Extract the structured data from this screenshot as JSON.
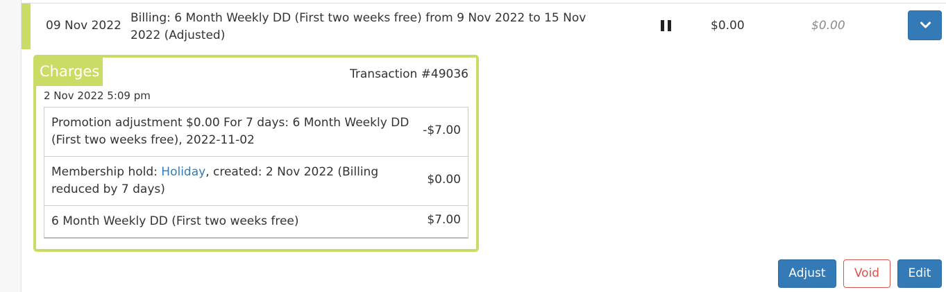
{
  "transaction_row": {
    "date": "09 Nov 2022",
    "description": "Billing: 6 Month Weekly DD (First two weeks free) from 9 Nov 2022 to 15 Nov 2022 (Adjusted)",
    "status_icon": "pause-icon",
    "amount": "$0.00",
    "balance": "$0.00",
    "expand_icon": "chevron-down-icon",
    "marker_color": "#cbdc66"
  },
  "charges_panel": {
    "tag": "Charges",
    "transaction_number": "Transaction #49036",
    "timestamp": "2 Nov 2022 5:09 pm",
    "accent_color": "#cbdc66",
    "items": [
      {
        "description": "Promotion adjustment $0.00 For 7 days: 6 Month Weekly DD (First two weeks free), 2022-11-02",
        "amount": "-$7.00"
      },
      {
        "prefix": "Membership hold: ",
        "link_text": "Holiday",
        "suffix": ", created: 2 Nov 2022 (Billing reduced by 7 days)",
        "amount": "$0.00"
      },
      {
        "description": "6 Month Weekly DD (First two weeks free)",
        "amount": "$7.00"
      }
    ]
  },
  "actions": {
    "adjust_label": "Adjust",
    "void_label": "Void",
    "edit_label": "Edit",
    "primary_color": "#337ab7",
    "danger_color": "#d9534f"
  }
}
